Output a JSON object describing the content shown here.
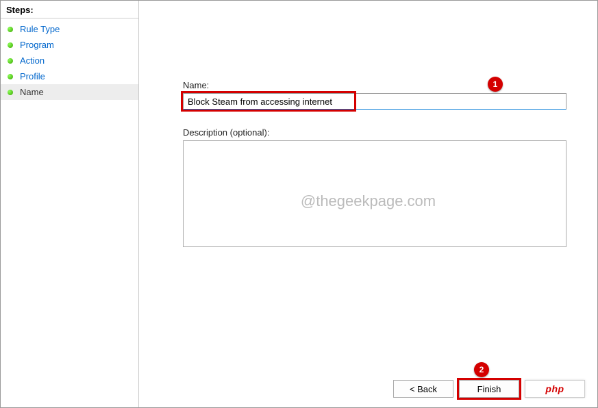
{
  "sidebar": {
    "header": "Steps:",
    "items": [
      {
        "label": "Rule Type",
        "active": false
      },
      {
        "label": "Program",
        "active": false
      },
      {
        "label": "Action",
        "active": false
      },
      {
        "label": "Profile",
        "active": false
      },
      {
        "label": "Name",
        "active": true
      }
    ]
  },
  "form": {
    "name_label": "Name:",
    "name_value": "Block Steam from accessing internet",
    "desc_label": "Description (optional):",
    "desc_value": ""
  },
  "buttons": {
    "back": "< Back",
    "finish": "Finish"
  },
  "watermark": "@thegeekpage.com",
  "annotations": {
    "marker1": "1",
    "marker2": "2"
  },
  "badge": {
    "php": "php"
  }
}
